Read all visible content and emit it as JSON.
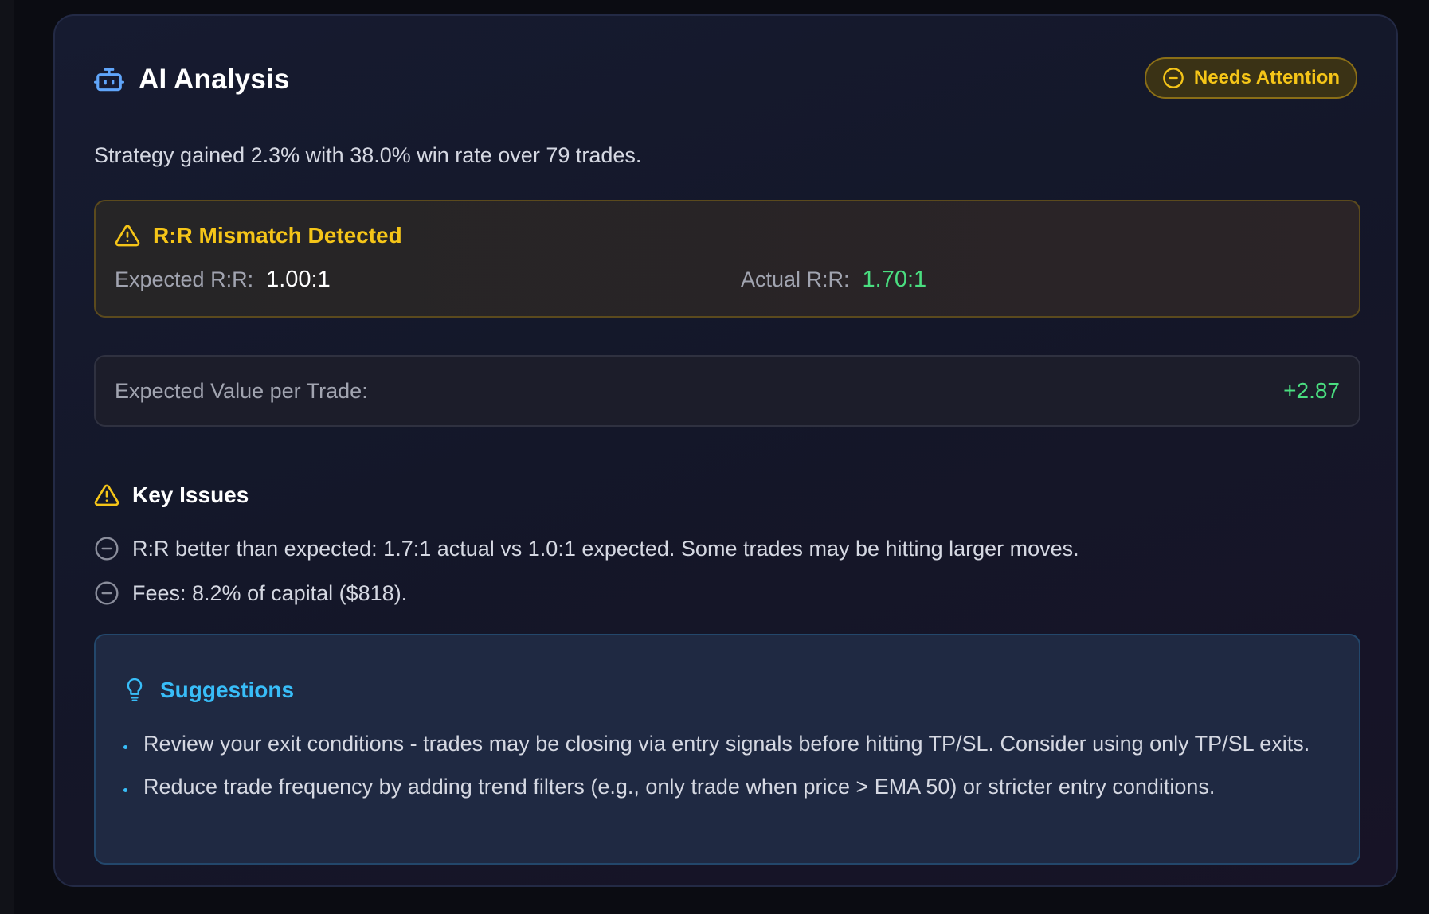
{
  "panel": {
    "title": "AI Analysis",
    "title_icon": "robot-icon",
    "status_badge": {
      "label": "Needs Attention",
      "icon": "minus-circle-icon",
      "color": "#f5c518"
    }
  },
  "summary": "Strategy gained 2.3% with 38.0% win rate over 79 trades.",
  "mismatch": {
    "title": "R:R Mismatch Detected",
    "icon": "warning-triangle-icon",
    "expected_label": "Expected R:R:",
    "expected_value": "1.00:1",
    "actual_label": "Actual R:R:",
    "actual_value": "1.70:1"
  },
  "expected_value": {
    "label": "Expected Value per Trade:",
    "value": "+2.87"
  },
  "key_issues": {
    "title": "Key Issues",
    "icon": "warning-triangle-icon",
    "items": [
      "R:R better than expected: 1.7:1 actual vs 1.0:1 expected. Some trades may be hitting larger moves.",
      "Fees: 8.2% of capital ($818)."
    ]
  },
  "suggestions": {
    "title": "Suggestions",
    "icon": "lightbulb-icon",
    "items": [
      "Review your exit conditions - trades may be closing via entry signals before hitting TP/SL. Consider using only TP/SL exits.",
      "Reduce trade frequency by adding trend filters (e.g., only trade when price > EMA 50) or stricter entry conditions."
    ]
  },
  "colors": {
    "accent_yellow": "#f5c518",
    "positive_green": "#4ade80",
    "info_blue": "#38bdf8",
    "robot_blue": "#60a5fa"
  }
}
